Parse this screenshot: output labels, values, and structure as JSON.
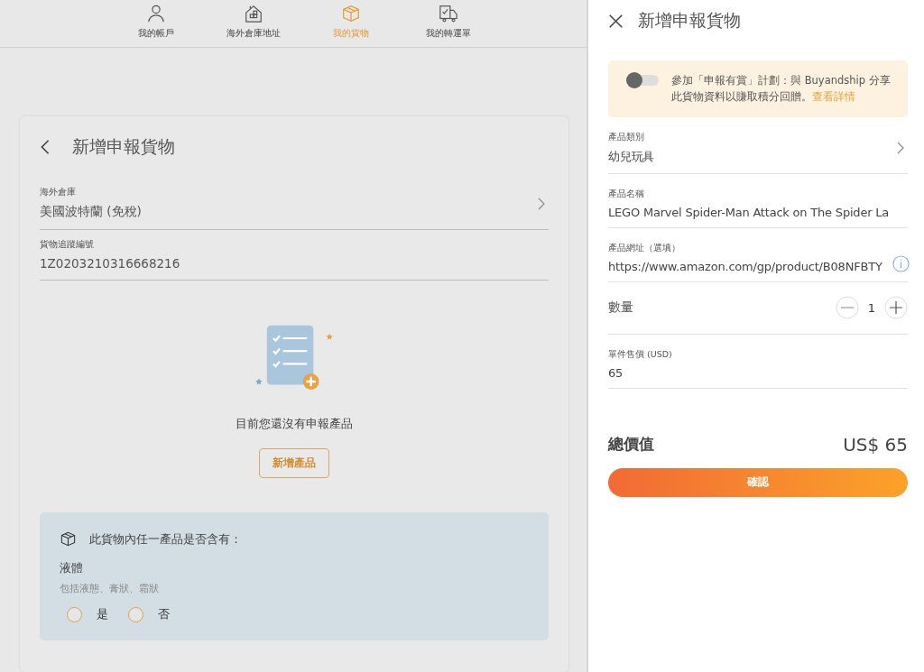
{
  "nav": {
    "tabs": [
      {
        "label": "我的帳戶",
        "kind": "person",
        "selected": false
      },
      {
        "label": "海外倉庫地址",
        "kind": "house",
        "selected": false
      },
      {
        "label": "我的貨物",
        "kind": "box",
        "selected": true
      },
      {
        "label": "我的轉運單",
        "kind": "truck",
        "selected": false
      }
    ]
  },
  "card": {
    "title": "新增申報貨物",
    "fields": [
      {
        "label": "海外倉庫",
        "value": "美國波特蘭 (免稅)",
        "kind": "select"
      },
      {
        "label": "貨物追蹤編號",
        "value": "1Z0203210316668216",
        "kind": "text"
      }
    ],
    "empty_state": {
      "message": "目前您還沒有申報產品",
      "button": "新增產品"
    },
    "question": {
      "title": "此貨物內任一產品是否含有：",
      "item": "液體",
      "hint": "包括液態、膏狀、霜狀",
      "options": [
        {
          "label": "是",
          "selected": false
        },
        {
          "label": "否",
          "selected": false
        }
      ]
    }
  },
  "drawer": {
    "title": "新增申報貨物",
    "banner": {
      "on": false,
      "text": "參加「申報有賞」計劃：與 Buyandship 分享此貨物資料以賺取積分回贈。",
      "link": "查看詳情"
    },
    "fields": [
      {
        "label": "產品類別",
        "value": "幼兒玩具",
        "kind": "select"
      },
      {
        "label": "產品名稱",
        "value": "LEGO Marvel Spider-Man Attack on The Spider La",
        "kind": "text"
      },
      {
        "label": "產品網址（選填）",
        "value": "https://www.amazon.com/gp/product/B08NFBTY",
        "kind": "info"
      }
    ],
    "quantity": {
      "label": "數量",
      "value": "1"
    },
    "price": {
      "label": "單件售價 (USD)",
      "value": "65"
    },
    "total": {
      "label": "總價值",
      "value": "US$ 65"
    },
    "confirm": "確認"
  }
}
